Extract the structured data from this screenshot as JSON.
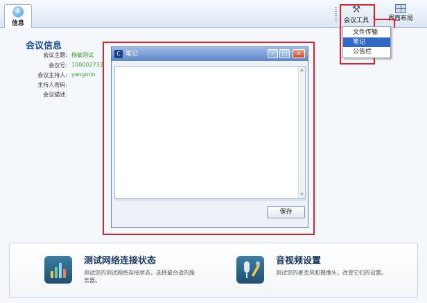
{
  "toolbar": {
    "info_tab_label": "信息",
    "meeting_tools_label": "会议工具",
    "layout_label": "界面布局"
  },
  "menu": {
    "items": [
      "文件传输",
      "笔记",
      "公告栏"
    ],
    "selected_index": 1
  },
  "info": {
    "title": "会议信息",
    "rows": [
      {
        "key": "会议主题:",
        "value": "杨敏测试"
      },
      {
        "key": "会议号:",
        "value": "100002732"
      },
      {
        "key": "会议主持人:",
        "value": "yangmin"
      },
      {
        "key": "主持人密码:",
        "value": ""
      },
      {
        "key": "会议描述:",
        "value": ""
      }
    ]
  },
  "notes_window": {
    "title": "笔记",
    "text": "",
    "save_label": "保存"
  },
  "cards": {
    "network": {
      "title": "测试网络连接状态",
      "desc": "测试您的测试网络连接状态，选择最合适的服务器。"
    },
    "av": {
      "title": "音视频设置",
      "desc": "测试您的麦克风和摄像头，改变它们的设置。"
    }
  },
  "colors": {
    "accent_red": "#d8262b",
    "title_blue": "#1d4f8c",
    "value_green": "#3a9a2a",
    "menu_selected": "#3169c6"
  }
}
